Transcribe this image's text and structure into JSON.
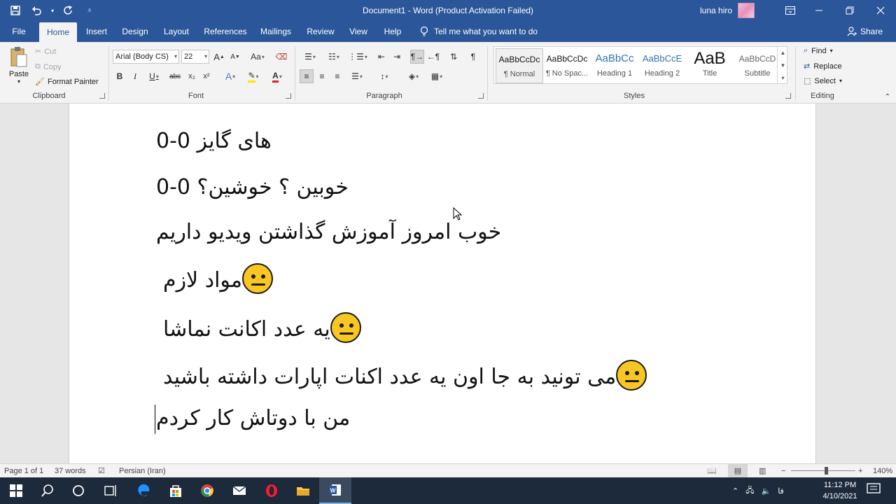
{
  "window": {
    "title": "Document1 - Word (Product Activation Failed)",
    "user_name": "luna hiro"
  },
  "tabs": [
    "File",
    "Home",
    "Insert",
    "Design",
    "Layout",
    "References",
    "Mailings",
    "Review",
    "View",
    "Help"
  ],
  "active_tab": "Home",
  "tell_me": "Tell me what you want to do",
  "share_label": "Share",
  "clipboard": {
    "paste": "Paste",
    "cut": "Cut",
    "copy": "Copy",
    "format_painter": "Format Painter",
    "group": "Clipboard"
  },
  "font": {
    "name": "Arial (Body CS)",
    "size": "22",
    "group": "Font",
    "bold": "B",
    "italic": "I",
    "underline": "U",
    "strike": "abc",
    "sub": "x₂",
    "sup": "x²",
    "grow": "A",
    "shrink": "A",
    "change_case": "Aa",
    "font_color": "A",
    "text_effects": "A"
  },
  "paragraph": {
    "group": "Paragraph"
  },
  "styles": {
    "group": "Styles",
    "items": [
      {
        "preview": "AaBbCcDc",
        "name": "¶ Normal"
      },
      {
        "preview": "AaBbCcDc",
        "name": "¶ No Spac..."
      },
      {
        "preview": "AaBbCc",
        "name": "Heading 1"
      },
      {
        "preview": "AaBbCcE",
        "name": "Heading 2"
      },
      {
        "preview": "AaB",
        "name": "Title"
      },
      {
        "preview": "AaBbCcD",
        "name": "Subtitle"
      }
    ]
  },
  "editing": {
    "group": "Editing",
    "find": "Find",
    "replace": "Replace",
    "select": "Select"
  },
  "document": {
    "lines": [
      "های گایز 0-0",
      "خوبین ؟ خوشین؟ 0-0",
      "خوب امروز آموزش گذاشتن ویدیو داریم",
      "مواد لازم",
      "یه عدد اکانت نماشا",
      "می تونید به جا اون یه عدد اکنات اپارات داشته باشید",
      "من با دوتاش کار کردم"
    ]
  },
  "status": {
    "page": "Page 1 of 1",
    "words": "37 words",
    "language": "Persian (Iran)",
    "zoom": "140%"
  },
  "taskbar": {
    "time": "11:12 PM",
    "date": "4/10/2021",
    "lang": "فا"
  },
  "colors": {
    "accent": "#2b579a",
    "taskbar": "#1c2a3c",
    "emoji": "#f9c623"
  }
}
